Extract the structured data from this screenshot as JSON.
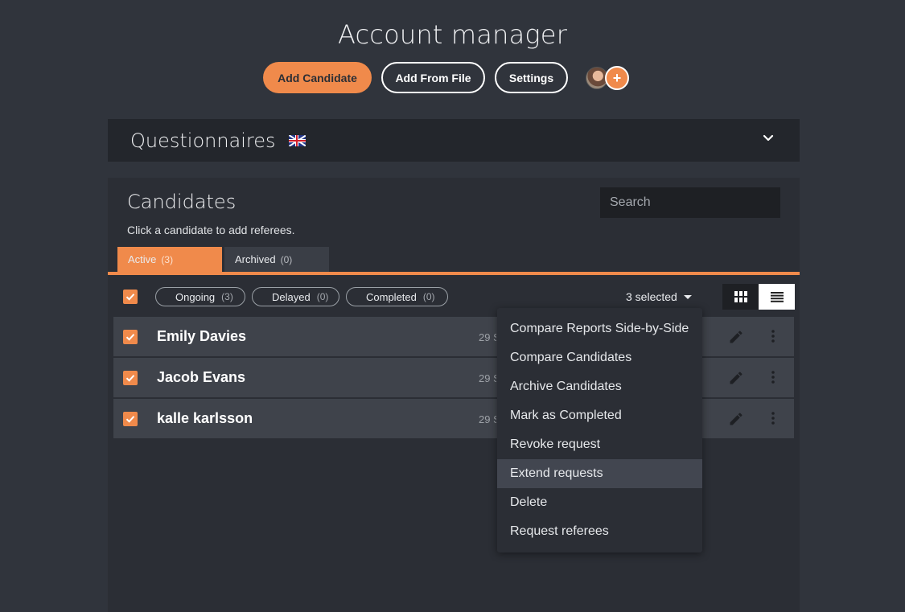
{
  "header": {
    "title": "Account manager",
    "add_candidate_label": "Add Candidate",
    "add_from_file_label": "Add From File",
    "settings_label": "Settings",
    "add_user_symbol": "+"
  },
  "questionnaires": {
    "title": "Questionnaires",
    "flag_icon": "uk-flag-icon",
    "toggle_icon": "chevron-down-icon"
  },
  "candidates": {
    "title": "Candidates",
    "subtitle": "Click a candidate to add referees.",
    "search_placeholder": "Search",
    "tabs": [
      {
        "label": "Active",
        "count": "(3)",
        "active": true
      },
      {
        "label": "Archived",
        "count": "(0)",
        "active": false
      }
    ],
    "filters": [
      {
        "label": "Ongoing",
        "count": "(3)"
      },
      {
        "label": "Delayed",
        "count": "(0)"
      },
      {
        "label": "Completed",
        "count": "(0)"
      }
    ],
    "selected_label": "3 selected",
    "rows": [
      {
        "name": "Emily Davies",
        "date": "29 S",
        "checked": true
      },
      {
        "name": "Jacob Evans",
        "date": "29 S",
        "checked": true
      },
      {
        "name": "kalle karlsson",
        "date": "29 S",
        "checked": true
      }
    ]
  },
  "dropdown_menu": {
    "items": [
      "Compare Reports Side-by-Side",
      "Compare Candidates",
      "Archive Candidates",
      "Mark as Completed",
      "Revoke request",
      "Extend requests",
      "Delete",
      "Request referees"
    ],
    "highlighted": "Extend requests"
  },
  "colors": {
    "accent": "#f08a4b",
    "background": "#30343c",
    "panel": "#2b2e35",
    "row": "#3f434b"
  }
}
